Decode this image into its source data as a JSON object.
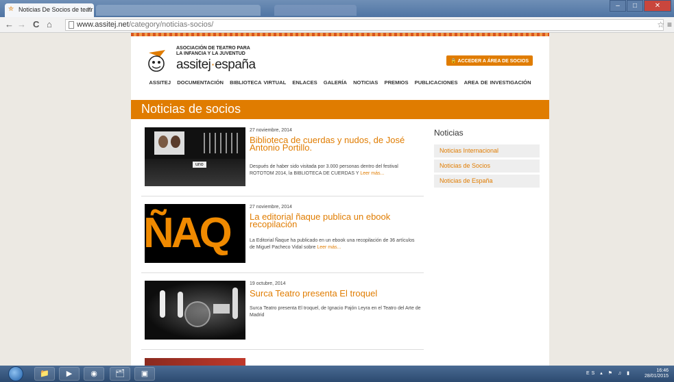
{
  "browser": {
    "tab_title": "Noticias De Socios de teatr",
    "tab_close": "×",
    "url_domain": "www.assitej.net",
    "url_path": "/category/noticias-socios/",
    "back": "←",
    "forward": "→",
    "reload": "C",
    "home": "⌂",
    "star": "☆",
    "menu": "≡",
    "minimize": "–",
    "maximize": "□",
    "close": "✕"
  },
  "site": {
    "logo_line1": "ASOCIACIÓN DE TEATRO PARA",
    "logo_line2": "LA INFANCIA Y LA JUVENTUD",
    "logo_main_a": "assitej",
    "logo_main_dot": "·",
    "logo_main_b": "españa",
    "socios_button": "ACCEDER A ÁREA DE SOCIOS",
    "nav": [
      "ASSITEJ",
      "DOCUMENTACIÓN",
      "BIBLIOTECA VIRTUAL",
      "ENLACES",
      "GALERÍA",
      "NOTICIAS",
      "PREMIOS",
      "PUBLICACIONES",
      "AREA DE INVESTIGACIÓN"
    ],
    "banner_title": "Noticias de socios"
  },
  "posts": [
    {
      "date": "27 noviembre, 2014",
      "title": "Biblioteca de cuerdas y nudos, de José Antonio Portillo.",
      "text": "Después de haber sido visitada por 3.000 personas dentro del festival ROTOTOM 2014, la BIBLIOTECA DE CUERDAS Y",
      "more": "Leer más...",
      "thumb_label": "uno"
    },
    {
      "date": "27 noviembre, 2014",
      "title": "La editorial ñaque publica un ebook recopilación",
      "text": "La Editorial Ñaque ha publicado en un ebook una recopilación de 36 artículos de Miguel Pacheco Vidal sobre",
      "more": "Leer más...",
      "thumb_label": "ÑAQ"
    },
    {
      "date": "19 octubre, 2014",
      "title": "Surca Teatro presenta El troquel",
      "text": "Surca Teatro  presenta El troquel,  de Ignacio Pajón Leyra en el Teatro del Arte de Madrid",
      "more": ""
    }
  ],
  "sidebar": {
    "heading": "Noticias",
    "items": [
      "Noticias Internacional",
      "Noticias de Socios",
      "Noticias de España"
    ]
  },
  "taskbar": {
    "lang": "ES",
    "time": "16:46",
    "date": "28/01/2015"
  },
  "colors": {
    "accent": "#e07c00",
    "page_bg": "#ece9e3"
  }
}
